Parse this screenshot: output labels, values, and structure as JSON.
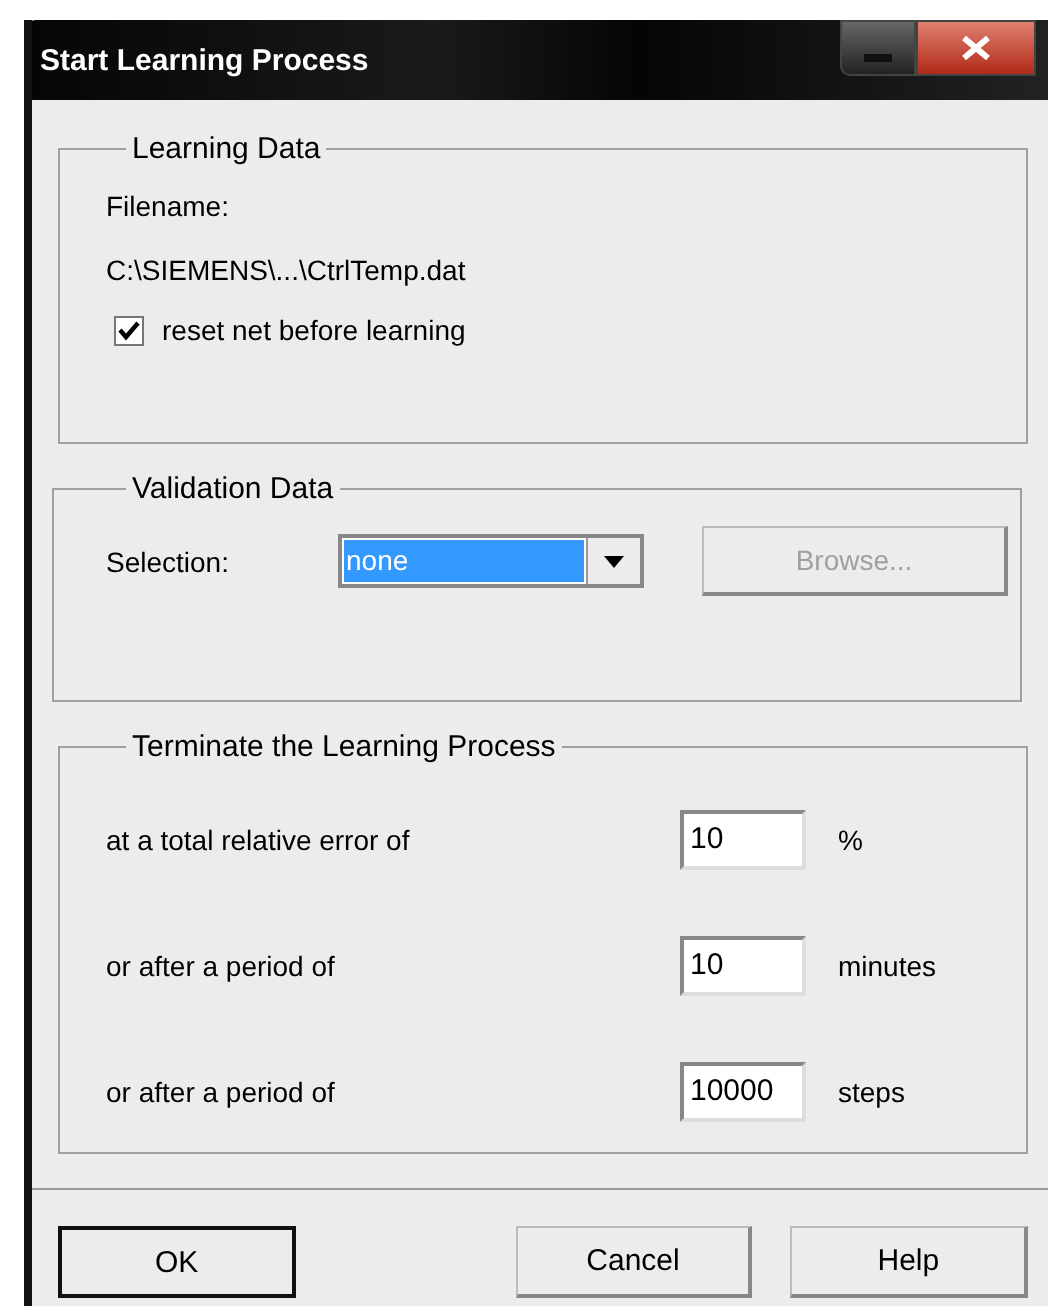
{
  "window": {
    "title": "Start Learning Process"
  },
  "learning_data": {
    "title": "Learning Data",
    "filename_label": "Filename:",
    "filename": "C:\\SIEMENS\\...\\CtrlTemp.dat",
    "reset_checkbox": {
      "label": "reset net before learning",
      "checked": true
    }
  },
  "validation_data": {
    "title": "Validation Data",
    "selection_label": "Selection:",
    "selection": {
      "value": "none",
      "focused": true
    },
    "browse_button": {
      "label": "Browse...",
      "disabled": true
    }
  },
  "terminate": {
    "title": "Terminate the Learning Process",
    "rows": [
      {
        "label": "at a total relative error of",
        "value": "10",
        "unit": "%"
      },
      {
        "label": "or after a period of",
        "value": "10",
        "unit": "minutes"
      },
      {
        "label": "or after a period of",
        "value": "10000",
        "unit": "steps"
      }
    ]
  },
  "buttons": [
    {
      "label": "OK",
      "default": true
    },
    {
      "label": "Cancel",
      "default": false
    },
    {
      "label": "Help",
      "default": false
    }
  ]
}
